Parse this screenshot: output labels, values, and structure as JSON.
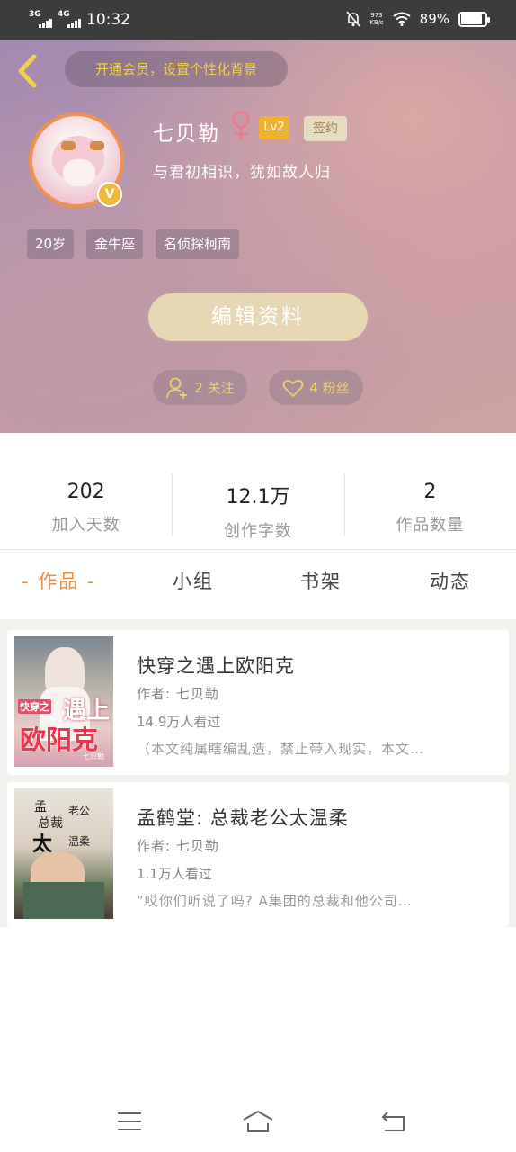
{
  "status_bar": {
    "net1": "3G",
    "net2": "4G",
    "time": "10:32",
    "speed_value": "973",
    "speed_unit": "KB/s",
    "battery": "89%",
    "battery_level": 0.89
  },
  "header": {
    "vip_banner": "开通会员，设置个性化背景",
    "username": "七贝勒",
    "level": "Lv2",
    "signed_badge": "签约",
    "verified_badge": "V",
    "bio": "与君初相识，犹如故人归",
    "tags": [
      "20岁",
      "金牛座",
      "名侦探柯南"
    ],
    "edit_button": "编辑资料",
    "follow_label": "2 关注",
    "fans_label": "4 粉丝"
  },
  "stats": [
    {
      "value": "202",
      "label": "加入天数"
    },
    {
      "value": "12.1万",
      "label": "创作字数"
    },
    {
      "value": "2",
      "label": "作品数量"
    }
  ],
  "tabs": [
    "- 作品 -",
    "小组",
    "书架",
    "动态"
  ],
  "works": [
    {
      "title": "快穿之遇上欧阳克",
      "author": "作者: 七贝勒",
      "views": "14.9万人看过",
      "desc": "（本文纯属瞎编乱造，禁止带入现实，本文…",
      "cover_text": [
        "快穿之",
        "遇上",
        "欧阳克",
        "七贝勒"
      ]
    },
    {
      "title": "孟鹤堂: 总裁老公太温柔",
      "author": "作者: 七贝勒",
      "views": "1.1万人看过",
      "desc": "“哎你们听说了吗? A集团的总裁和他公司…",
      "cover_text": [
        "孟",
        "总裁",
        "太",
        "老公",
        "温柔"
      ]
    }
  ],
  "colors": {
    "accent": "#ef8a4b",
    "gold": "#f3cf4a",
    "level_badge": "#f2b02f",
    "edit_button": "#e7d7b3"
  },
  "icons": {
    "back": "chevron-left-icon",
    "gender": "female-icon",
    "follow": "user-plus-icon",
    "fans": "heart-icon",
    "nav_menu": "menu-icon",
    "nav_home": "home-icon",
    "nav_back": "back-icon"
  }
}
